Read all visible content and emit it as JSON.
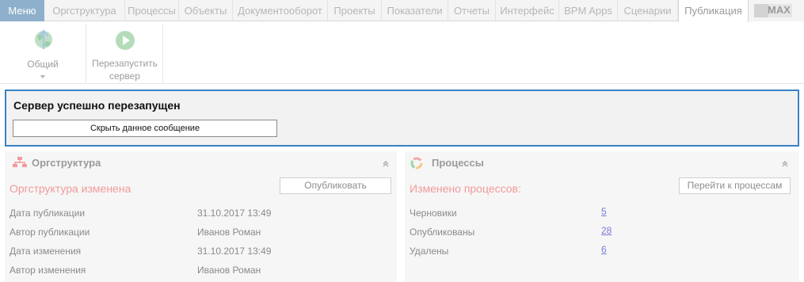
{
  "menu": {
    "label": "Меню"
  },
  "tabs": [
    {
      "label": "Оргструктура"
    },
    {
      "label": "Процессы"
    },
    {
      "label": "Объекты"
    },
    {
      "label": "Документооборот"
    },
    {
      "label": "Проекты"
    },
    {
      "label": "Показатели"
    },
    {
      "label": "Отчеты"
    },
    {
      "label": "Интерфейс"
    },
    {
      "label": "BPM Apps"
    },
    {
      "label": "Сценарии"
    },
    {
      "label": "Публикация"
    }
  ],
  "active_tab": "Публикация",
  "max_badge": "MAX",
  "toolbar": {
    "general_label": "Общий",
    "restart_label": "Перезапустить",
    "restart_label_2": "сервер"
  },
  "notice": {
    "title": "Сервер успешно перезапущен",
    "hide_button": "Скрыть данное сообщение"
  },
  "orgstructure": {
    "title": "Оргструктура",
    "status": "Оргструктура изменена",
    "publish_button": "Опубликовать",
    "rows": [
      {
        "label": "Дата публикации",
        "value": "31.10.2017 13:49"
      },
      {
        "label": "Автор публикации",
        "value": "Иванов Роман"
      },
      {
        "label": "Дата изменения",
        "value": "31.10.2017 13:49"
      },
      {
        "label": "Автор изменения",
        "value": "Иванов Роман"
      }
    ]
  },
  "processes": {
    "title": "Процессы",
    "status": "Изменено процессов:",
    "go_button": "Перейти к процессам",
    "rows": [
      {
        "label": "Черновики",
        "value": "5"
      },
      {
        "label": "Опубликованы",
        "value": "28"
      },
      {
        "label": "Удалены",
        "value": "6"
      }
    ]
  },
  "colors": {
    "menu_bg": "#8fb0cc",
    "notice_border": "#3a82c4",
    "status_text": "#f19a9a",
    "link": "#7b7bd8"
  }
}
